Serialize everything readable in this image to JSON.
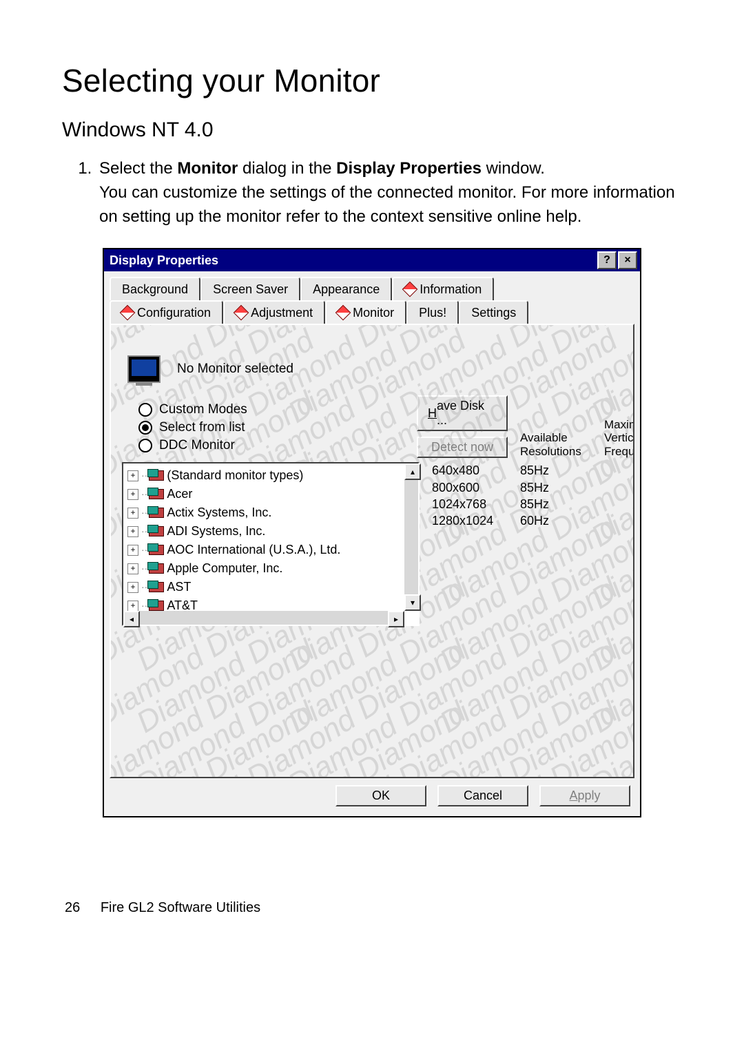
{
  "page": {
    "title": "Selecting your Monitor",
    "subtitle": "Windows NT 4.0",
    "step_prefix": "Select the ",
    "step_bold1": "Monitor",
    "step_mid": " dialog in the ",
    "step_bold2": "Display Properties",
    "step_end": " window.",
    "step_para": "You can customize the settings of the connected monitor. For more information on setting up the monitor refer to the context sensitive online help."
  },
  "dialog": {
    "title": "Display Properties",
    "help_btn": "?",
    "close_btn": "×",
    "tabs_row1": [
      "Background",
      "Screen Saver",
      "Appearance",
      "Information"
    ],
    "tabs_row2": [
      "Configuration",
      "Adjustment",
      "Monitor",
      "Plus!",
      "Settings"
    ],
    "active_tab": "Monitor",
    "monitor_status": "No Monitor selected",
    "radios": {
      "custom": "Custom Modes",
      "selectlist": "Select from list",
      "ddc": "DDC Monitor",
      "selected": "selectlist"
    },
    "buttons": {
      "have_disk_u": "H",
      "have_disk_rest": "ave Disk ...",
      "detect_now": "Detect now",
      "ok": "OK",
      "cancel": "Cancel",
      "apply_u": "A",
      "apply_rest": "pply"
    },
    "headers": {
      "col1": "Available Resolutions",
      "col2a": "Maximum",
      "col2b": "Vertical",
      "col2c": "Frequency"
    },
    "tree": [
      "(Standard monitor types)",
      "Acer",
      "Actix Systems, Inc.",
      "ADI Systems, Inc.",
      "AOC International (U.S.A.), Ltd.",
      "Apple Computer, Inc.",
      "AST",
      "AT&T"
    ],
    "resolutions": [
      {
        "res": "640x480",
        "hz": "85Hz"
      },
      {
        "res": "800x600",
        "hz": "85Hz"
      },
      {
        "res": "1024x768",
        "hz": "85Hz"
      },
      {
        "res": "1280x1024",
        "hz": "60Hz"
      }
    ],
    "watermark_word": "Diamond"
  },
  "footer": {
    "page_num": "26",
    "section": "Fire GL2 Software Utilities"
  }
}
